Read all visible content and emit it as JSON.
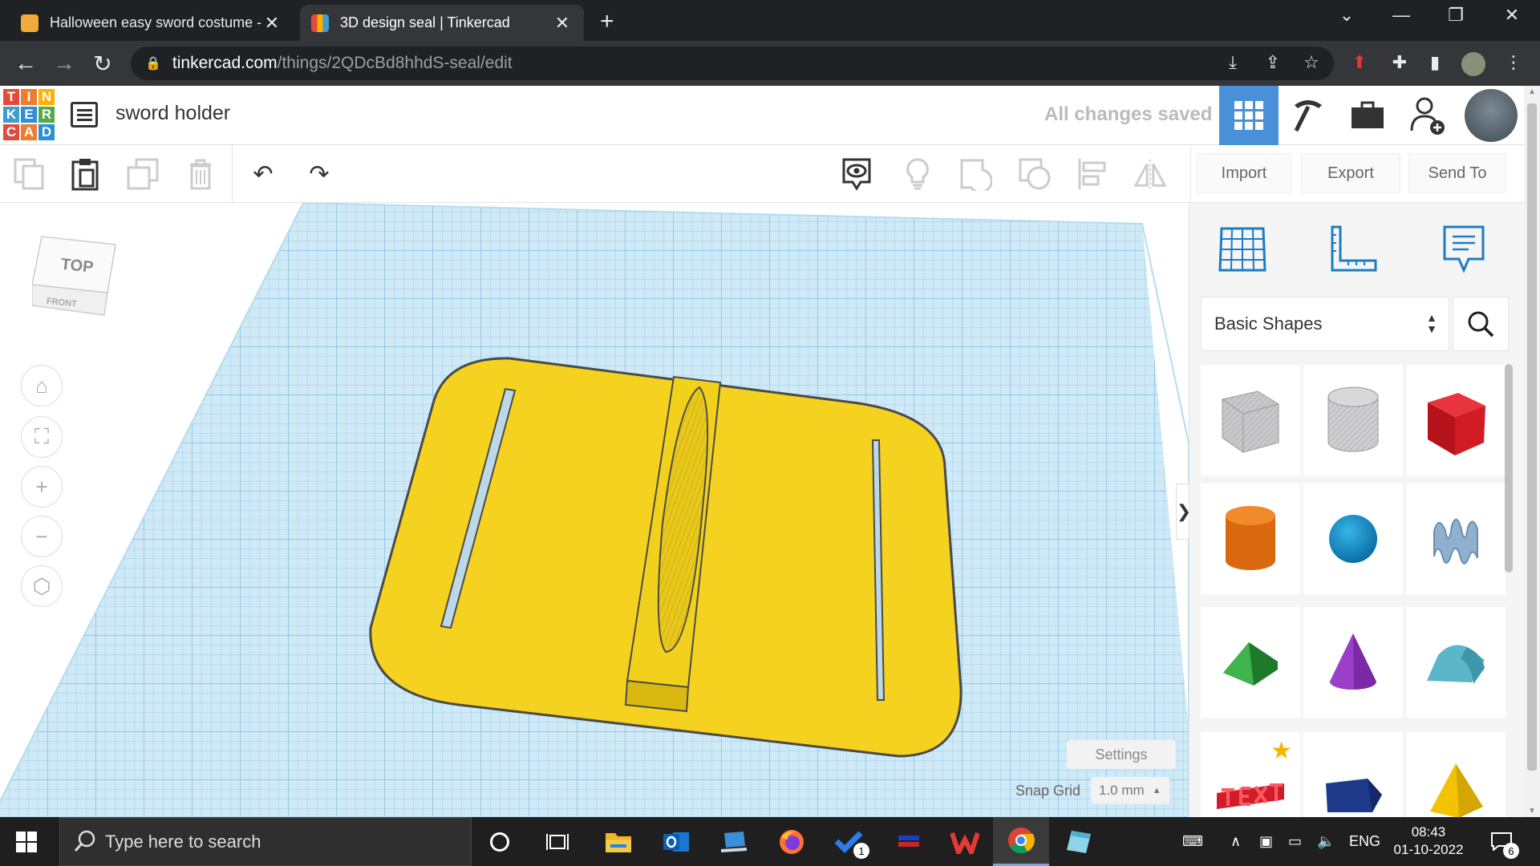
{
  "browser": {
    "tabs": [
      {
        "title": "Halloween easy sword costume -",
        "state": "inactive"
      },
      {
        "title": "3D design seal | Tinkercad",
        "state": "active"
      }
    ],
    "url_host": "tinkercad.com",
    "url_path": "/things/2QDcBd8hhdS-seal/edit"
  },
  "app": {
    "logo_letters": [
      "T",
      "I",
      "N",
      "K",
      "E",
      "R",
      "C",
      "A",
      "D"
    ],
    "logo_colors": [
      "#e24b3b",
      "#ed7d31",
      "#ffb000",
      "#3c9dd0",
      "#2d8fd5",
      "#56a84a",
      "#e24b3b",
      "#ed7d31",
      "#2d8fd5"
    ],
    "design_title": "sword holder",
    "save_status": "All changes saved",
    "accent_color": "#4a90d9"
  },
  "toolbar": {
    "import_label": "Import",
    "export_label": "Export",
    "sendto_label": "Send To"
  },
  "viewcube": {
    "top_label": "TOP",
    "front_label": "FRONT"
  },
  "workplane": {
    "settings_label": "Settings",
    "snap_label": "Snap Grid",
    "snap_value": "1.0 mm",
    "collapse_glyph": "❯",
    "object_color": "#f4d21f"
  },
  "shapes_panel": {
    "category": "Basic Shapes",
    "shapes": [
      "Box (hole)",
      "Cylinder (hole)",
      "Box",
      "Cylinder",
      "Sphere",
      "Scribble",
      "Roof",
      "Cone",
      "Round Roof",
      "Text",
      "Polygon",
      "Pyramid"
    ]
  },
  "taskbar": {
    "search_placeholder": "Type here to search",
    "language": "ENG",
    "time": "08:43",
    "date": "01-10-2022",
    "notification_count": "6",
    "badge_count": "1"
  }
}
